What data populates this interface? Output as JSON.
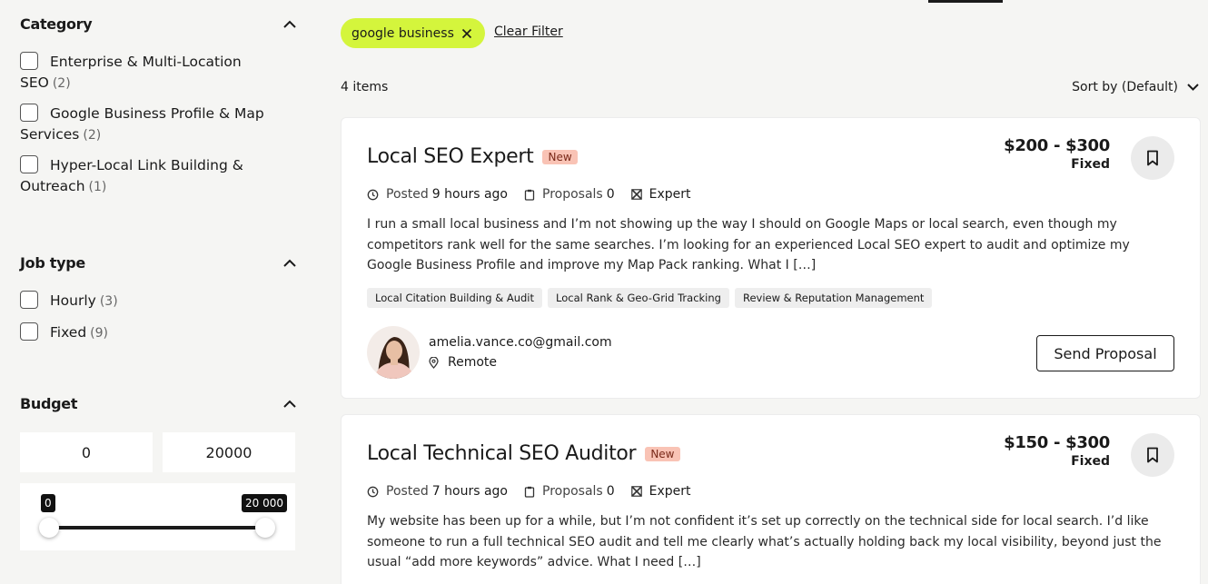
{
  "sidebar": {
    "category": {
      "title": "Category",
      "options": [
        {
          "label": "Enterprise & Multi-Location SEO",
          "count": "(2)"
        },
        {
          "label": "Google Business Profile & Map Services",
          "count": "(2)"
        },
        {
          "label": "Hyper-Local Link Building & Outreach",
          "count": "(1)"
        }
      ]
    },
    "job_type": {
      "title": "Job type",
      "options": [
        {
          "label": "Hourly",
          "count": "(3)"
        },
        {
          "label": "Fixed",
          "count": "(9)"
        }
      ]
    },
    "budget": {
      "title": "Budget",
      "min_value": "0",
      "max_value": "20000",
      "slider_min_label": "0",
      "slider_max_label": "20 000",
      "range_low_fraction": 0,
      "range_high_fraction": 1
    }
  },
  "filters": {
    "active_chip": "google business",
    "clear_label": "Clear Filter"
  },
  "results": {
    "count_label": "4 items",
    "sort_label": "Sort by (Default)"
  },
  "jobs": [
    {
      "title": "Local SEO Expert",
      "badge": "New",
      "price_range": "$200 - $300",
      "price_type": "Fixed",
      "posted_label": "Posted",
      "posted_value": "9 hours ago",
      "proposals_label": "Proposals",
      "proposals_value": "0",
      "level": "Expert",
      "description": "I run a small local business and I’m not showing up the way I should on Google Maps or local search, even though my competitors rank well for the same searches. I’m looking for an experienced Local SEO expert to audit and optimize my Google Business Profile and improve my Map Pack ranking. What I […]",
      "tags": [
        "Local Citation Building & Audit",
        "Local Rank & Geo-Grid Tracking",
        "Review & Reputation Management"
      ],
      "author_email": "amelia.vance.co@gmail.com",
      "author_location": "Remote",
      "action_label": "Send Proposal"
    },
    {
      "title": "Local Technical SEO Auditor",
      "badge": "New",
      "price_range": "$150 - $300",
      "price_type": "Fixed",
      "posted_label": "Posted",
      "posted_value": "7 hours ago",
      "proposals_label": "Proposals",
      "proposals_value": "0",
      "level": "Expert",
      "description": "My website has been up for a while, but I’m not confident it’s set up correctly on the technical side for local search. I’d like someone to run a full technical SEO audit and tell me clearly what’s actually holding back my local visibility, beyond just the usual “add more keywords” advice. What I need […]"
    }
  ],
  "colors": {
    "chip": "#d4f53c",
    "badge_new": "#f9c3b5",
    "background": "#f5f5f3"
  }
}
